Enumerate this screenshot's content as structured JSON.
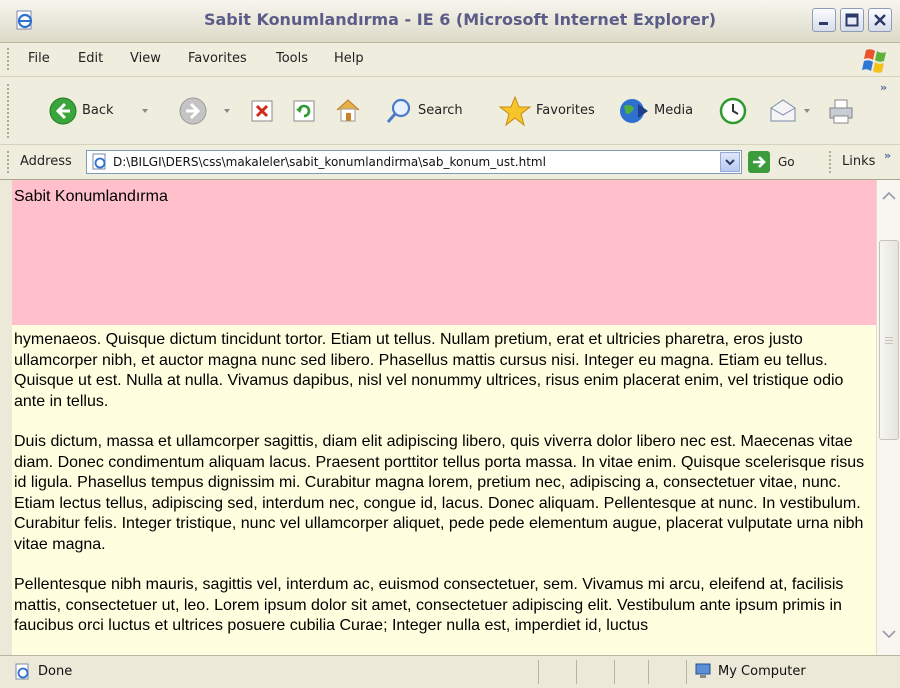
{
  "window": {
    "title": "Sabit Konumlandırma - IE 6 (Microsoft Internet Explorer)"
  },
  "menu": [
    "File",
    "Edit",
    "View",
    "Favorites",
    "Tools",
    "Help"
  ],
  "toolbar": {
    "back_label": "Back",
    "search_label": "Search",
    "favorites_label": "Favorites",
    "media_label": "Media"
  },
  "address": {
    "label": "Address",
    "url": "D:\\BILGI\\DERS\\css\\makaleler\\sabit_konumlandirma\\sab_konum_ust.html",
    "go_label": "Go",
    "links_label": "Links"
  },
  "page": {
    "header_text": "Sabit Konumlandırma",
    "header_color": "#ffc0cb",
    "body_color": "#ffffe0",
    "paragraphs": [
      "hymenaeos. Quisque dictum tincidunt tortor. Etiam ut tellus. Nullam pretium, erat et ultricies pharetra, eros justo ullamcorper nibh, et auctor magna nunc sed libero. Phasellus mattis cursus nisi. Integer eu magna. Etiam eu tellus. Quisque ut est. Nulla at nulla. Vivamus dapibus, nisl vel nonummy ultrices, risus enim placerat enim, vel tristique odio ante in tellus.",
      "Duis dictum, massa et ullamcorper sagittis, diam elit adipiscing libero, quis viverra dolor libero nec est. Maecenas vitae diam. Donec condimentum aliquam lacus. Praesent porttitor tellus porta massa. In vitae enim. Quisque scelerisque risus id ligula. Phasellus tempus dignissim mi. Curabitur magna lorem, pretium nec, adipiscing a, consectetuer vitae, nunc. Etiam lectus tellus, adipiscing sed, interdum nec, congue id, lacus. Donec aliquam. Pellentesque at nunc. In vestibulum. Curabitur felis. Integer tristique, nunc vel ullamcorper aliquet, pede pede elementum augue, placerat vulputate urna nibh vitae magna.",
      "Pellentesque nibh mauris, sagittis vel, interdum ac, euismod consectetuer, sem. Vivamus mi arcu, eleifend at, facilisis mattis, consectetuer ut, leo. Lorem ipsum dolor sit amet, consectetuer adipiscing elit. Vestibulum ante ipsum primis in faucibus orci luctus et ultrices posuere cubilia Curae; Integer nulla est, imperdiet id, luctus"
    ]
  },
  "status": {
    "text": "Done",
    "zone": "My Computer"
  }
}
